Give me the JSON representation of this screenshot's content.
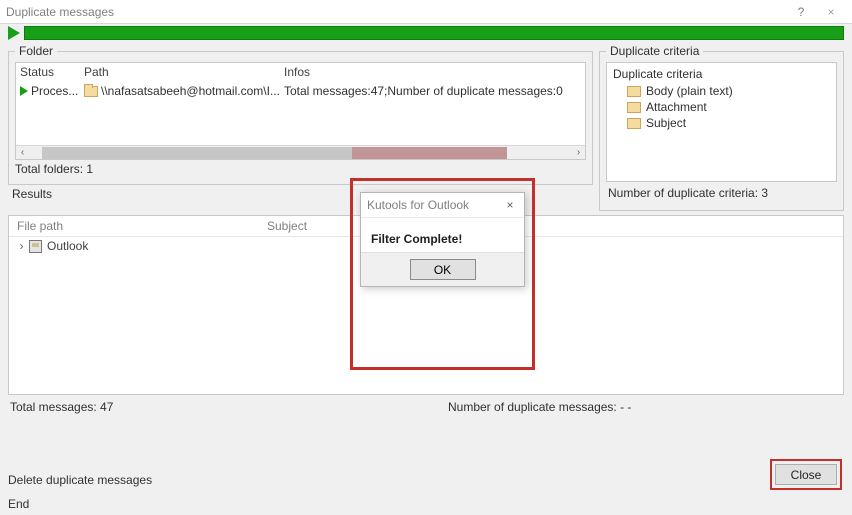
{
  "window": {
    "title": "Duplicate messages",
    "help_glyph": "?",
    "close_glyph": "×"
  },
  "folder": {
    "legend": "Folder",
    "headers": {
      "status": "Status",
      "path": "Path",
      "infos": "Infos"
    },
    "row": {
      "status": "Proces...",
      "path": "\\\\nafasatsabeeh@hotmail.com\\I...",
      "infos": "Total messages:47;Number of duplicate messages:0"
    },
    "total_label": "Total folders: 1"
  },
  "criteria": {
    "legend": "Duplicate criteria",
    "header": "Duplicate criteria",
    "items": [
      "Body (plain text)",
      "Attachment",
      "Subject"
    ],
    "count_label": "Number of duplicate criteria: 3"
  },
  "results": {
    "legend": "Results",
    "headers": {
      "filepath": "File path",
      "subject": "Subject"
    },
    "tree_root": "Outlook",
    "total_messages": "Total messages: 47",
    "num_dup": "Number of duplicate messages: - -"
  },
  "footer": {
    "delete_label": "Delete duplicate messages",
    "close_label": "Close",
    "end_label": "End"
  },
  "dialog": {
    "title": "Kutools for Outlook",
    "message": "Filter Complete!",
    "ok": "OK",
    "close_glyph": "×"
  },
  "scroll": {
    "left_glyph": "‹",
    "right_glyph": "›"
  }
}
